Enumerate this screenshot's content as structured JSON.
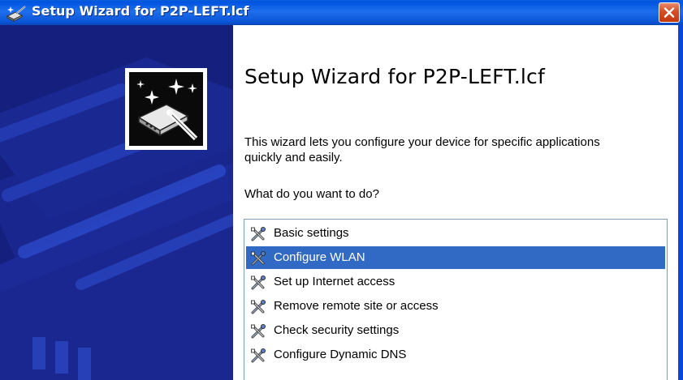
{
  "window": {
    "title": "Setup Wizard for P2P-LEFT.lcf"
  },
  "main": {
    "heading": "Setup Wizard for P2P-LEFT.lcf",
    "description": "This wizard lets you configure your device for specific applications quickly and easily.",
    "question": "What do you want to do?"
  },
  "tasks": {
    "items": [
      {
        "label": "Basic settings",
        "icon": "wizard-tools-icon"
      },
      {
        "label": "Configure WLAN",
        "icon": "wizard-tools-icon",
        "selected": true
      },
      {
        "label": "Set up Internet access",
        "icon": "wizard-tools-icon"
      },
      {
        "label": "Remove remote site or access",
        "icon": "wizard-tools-icon"
      },
      {
        "label": "Check security settings",
        "icon": "wizard-tools-icon"
      },
      {
        "label": "Configure Dynamic DNS",
        "icon": "wizard-tools-icon"
      }
    ]
  },
  "colors": {
    "titlebar": "#0053e0",
    "sidepanel": "#15207e",
    "selection": "#316ac5",
    "close_button": "#d54d26"
  }
}
